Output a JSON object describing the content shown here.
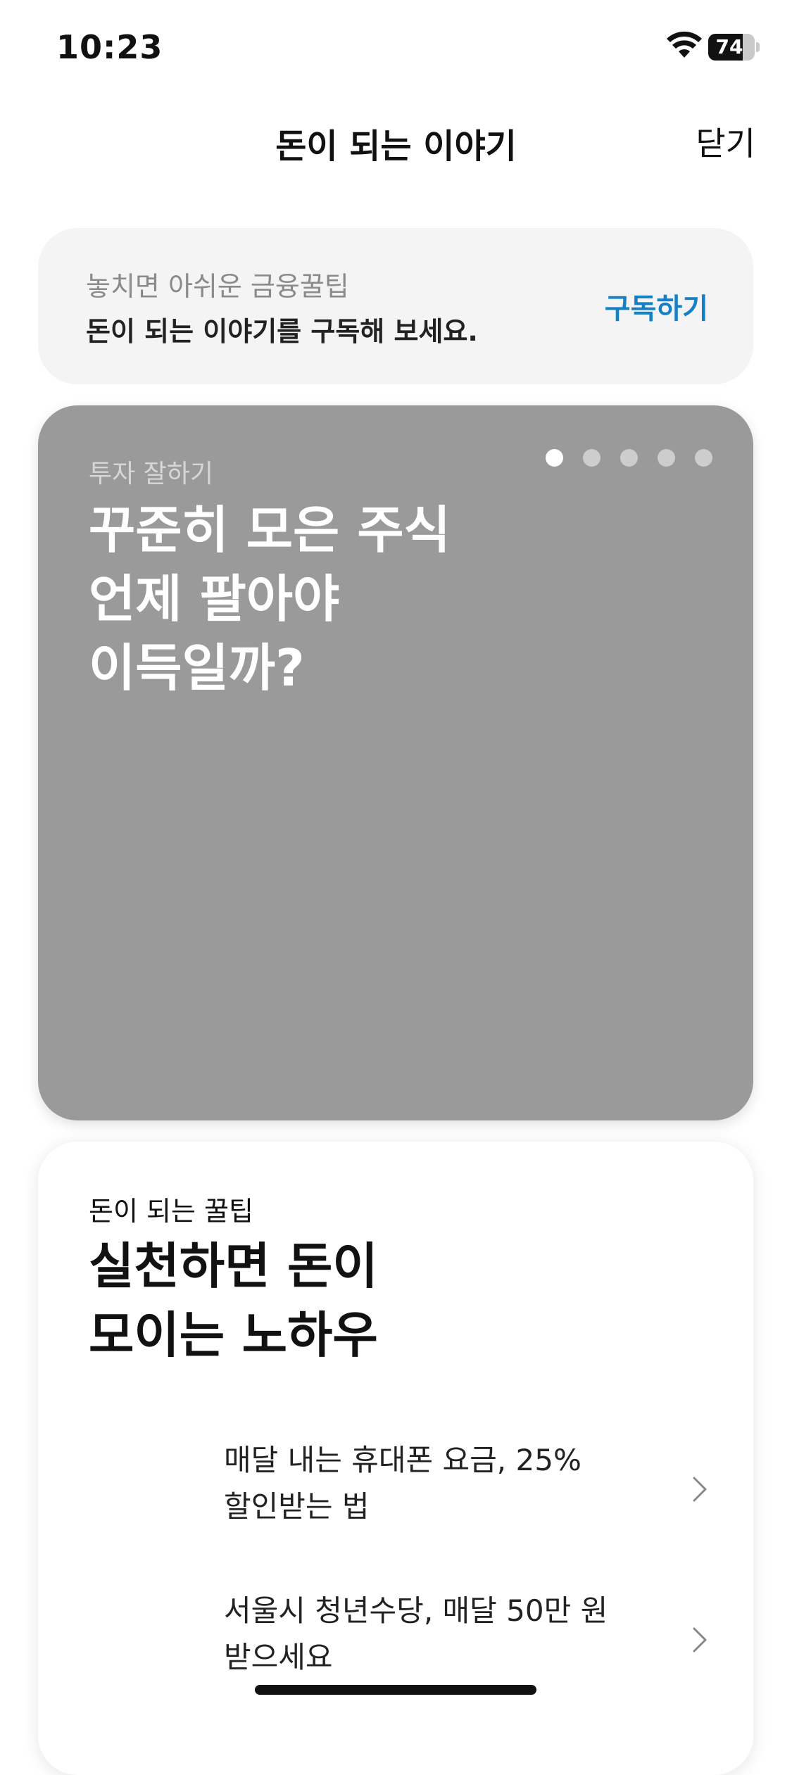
{
  "status_bar": {
    "time": "10:23",
    "battery_level": "74",
    "battery_fraction": 0.74,
    "icons": [
      "wifi-icon",
      "battery-icon"
    ]
  },
  "nav": {
    "title": "돈이 되는 이야기",
    "close_label": "닫기"
  },
  "subscribe": {
    "line1": "놓치면 아쉬운 금융꿀팁",
    "line2": "돈이 되는 이야기를 구독해 보세요.",
    "button_label": "구독하기"
  },
  "story": {
    "category": "투자 잘하기",
    "title": "꾸준히 모은 주식\n언제 팔아야\n이득일까?",
    "pager_total": 5,
    "pager_active": 1
  },
  "tips": {
    "eyebrow": "돈이 되는 꿀팁",
    "title": "실천하면 돈이\n모이는 노하우",
    "items": [
      {
        "label": "매달 내는 휴대폰 요금, 25%\n할인받는 법"
      },
      {
        "label": "서울시 청년수당, 매달 50만 원\n받으세요"
      }
    ]
  },
  "colors": {
    "accent": "#1580c6",
    "story_card_bg": "#9a9a9a",
    "subscribe_card_bg": "#f4f4f4"
  }
}
